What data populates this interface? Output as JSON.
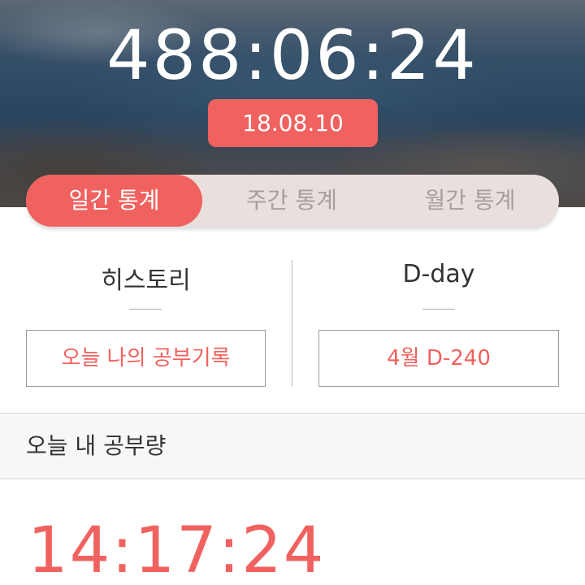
{
  "header": {
    "total_time": "488:06:24",
    "date": "18.08.10"
  },
  "tabs": [
    {
      "label": "일간 통계",
      "active": true
    },
    {
      "label": "주간 통계",
      "active": false
    },
    {
      "label": "월간 통계",
      "active": false
    }
  ],
  "history": {
    "title": "히스토리",
    "button_label": "오늘 나의 공부기록"
  },
  "dday": {
    "title": "D-day",
    "button_label": "4월 D-240"
  },
  "today": {
    "section_title": "오늘 내 공부량",
    "time": "14:17:24"
  },
  "colors": {
    "accent": "#f0625f",
    "tab_inactive_bg": "#e9dfdc",
    "tab_inactive_text": "#a89f9c"
  }
}
